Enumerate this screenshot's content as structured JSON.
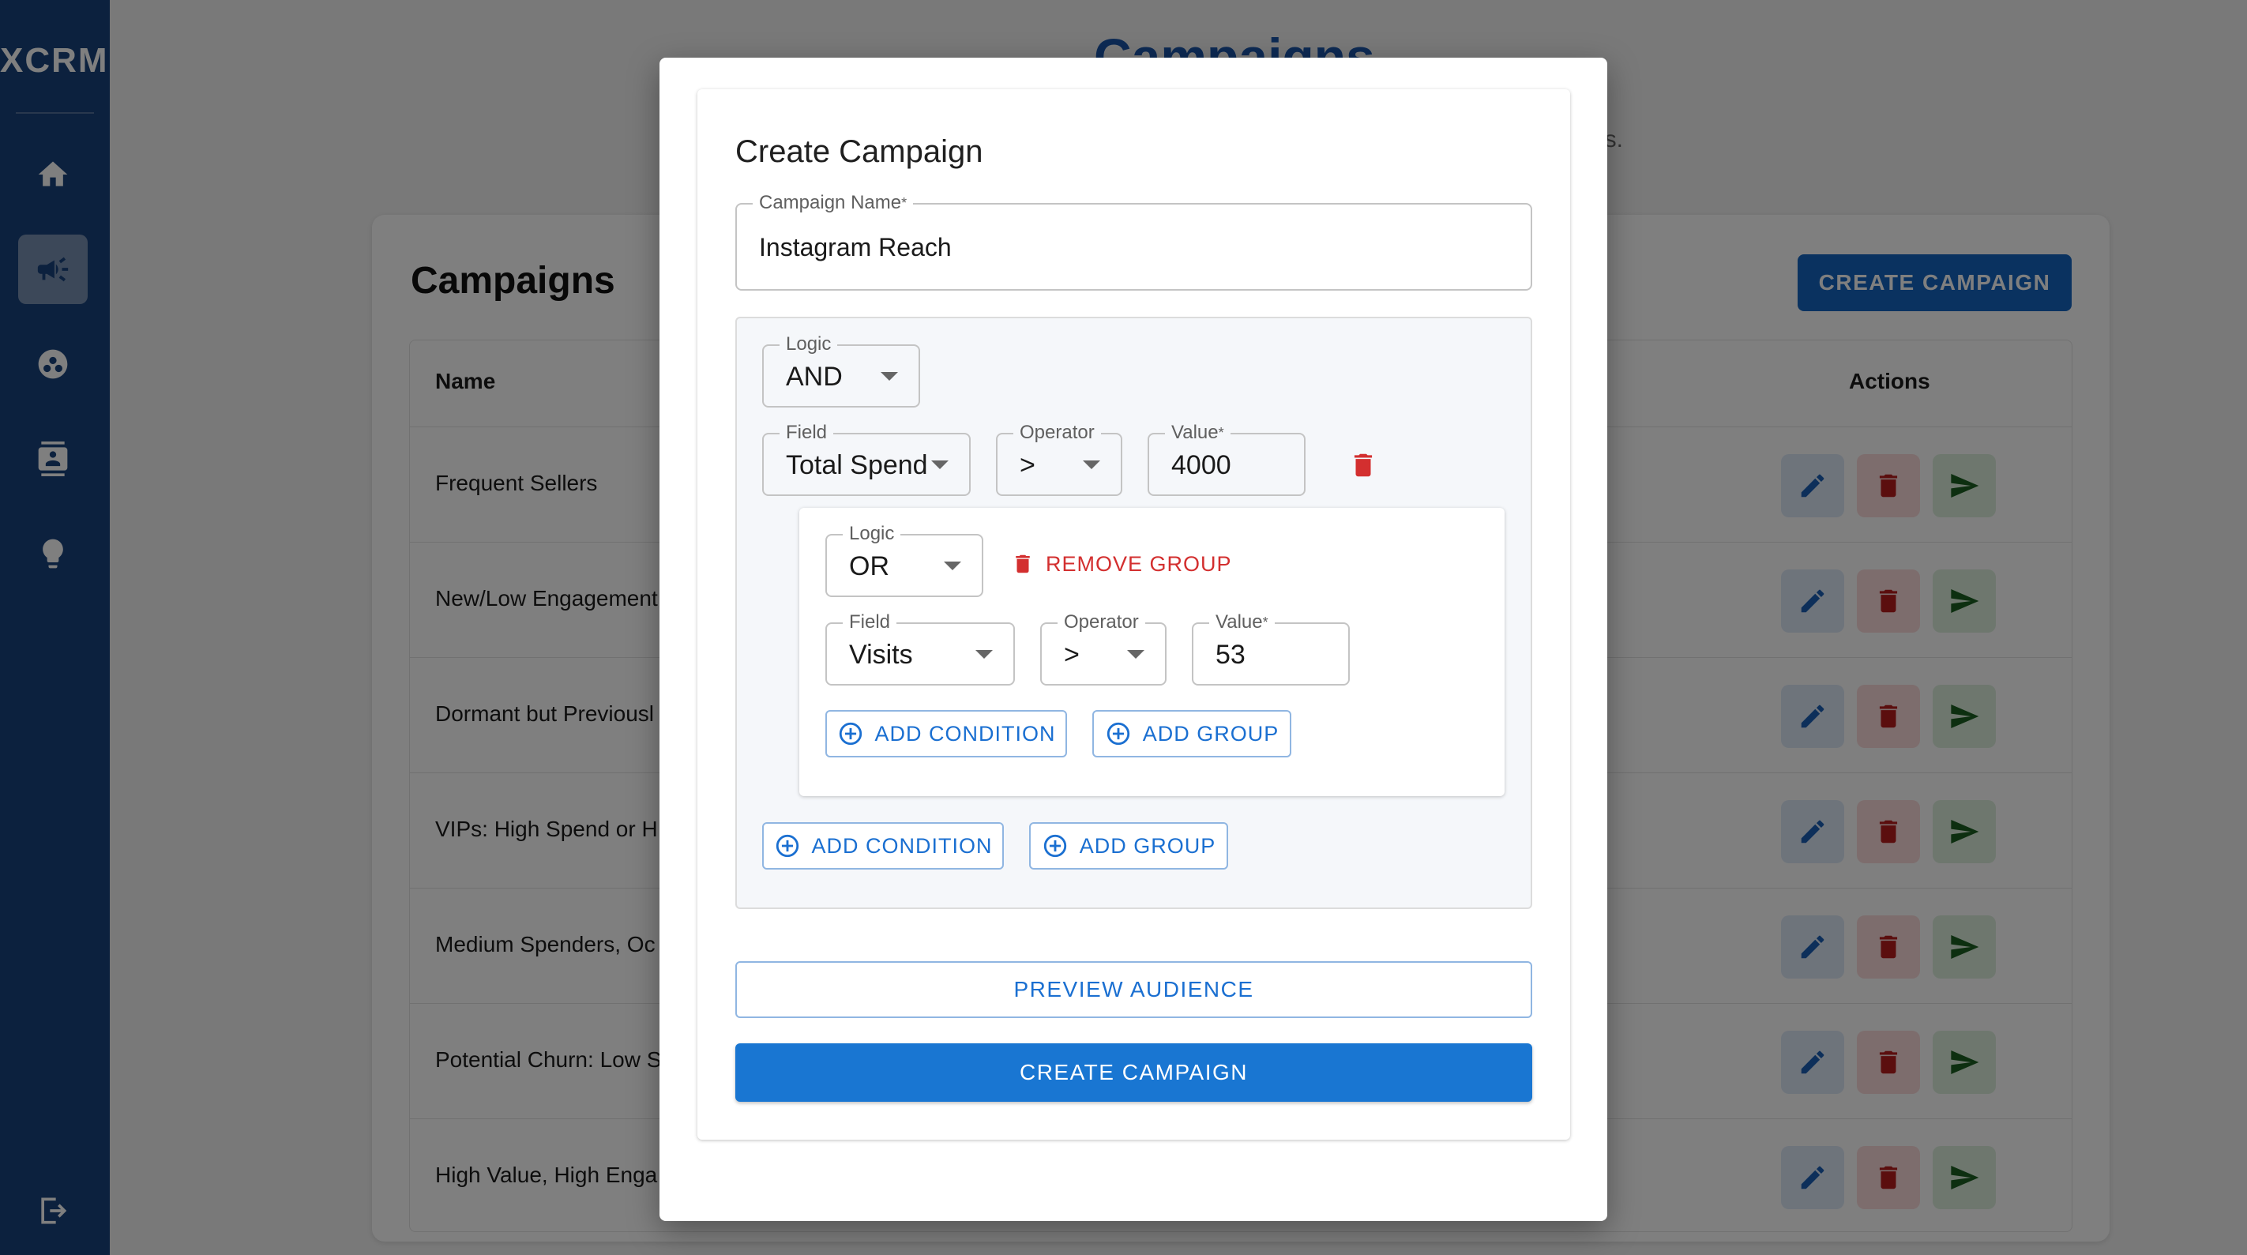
{
  "app": {
    "brand": "XCRM"
  },
  "sidebar": {
    "items": [
      {
        "icon": "home-icon"
      },
      {
        "icon": "megaphone-icon",
        "active": true
      },
      {
        "icon": "segments-icon"
      },
      {
        "icon": "contacts-icon"
      },
      {
        "icon": "lightbulb-icon"
      }
    ],
    "logout_icon": "logout-icon"
  },
  "page": {
    "title": "Campaigns",
    "subtitle_fragment": "ics.",
    "card_title": "Campaigns",
    "create_button": "CREATE CAMPAIGN",
    "table": {
      "columns": {
        "name": "Name",
        "actions": "Actions"
      },
      "rows": [
        {
          "name": "Frequent Sellers"
        },
        {
          "name": "New/Low Engagement"
        },
        {
          "name": "Dormant but Previousl"
        },
        {
          "name": "VIPs: High Spend or H"
        },
        {
          "name": "Medium Spenders, Oc"
        },
        {
          "name": "Potential Churn: Low S"
        },
        {
          "name": "High Value, High Enga"
        }
      ]
    }
  },
  "modal": {
    "title": "Create Campaign",
    "campaign_name": {
      "label": "Campaign Name",
      "required": "*",
      "value": "Instagram Reach"
    },
    "root_group": {
      "logic": {
        "label": "Logic",
        "value": "AND"
      },
      "condition": {
        "field": {
          "label": "Field",
          "value": "Total Spend"
        },
        "operator": {
          "label": "Operator",
          "value": ">"
        },
        "value": {
          "label": "Value",
          "required": "*",
          "value": "4000"
        }
      },
      "add_condition": "ADD CONDITION",
      "add_group": "ADD GROUP"
    },
    "nested_group": {
      "logic": {
        "label": "Logic",
        "value": "OR"
      },
      "remove_group": "REMOVE GROUP",
      "condition": {
        "field": {
          "label": "Field",
          "value": "Visits"
        },
        "operator": {
          "label": "Operator",
          "value": ">"
        },
        "value": {
          "label": "Value",
          "required": "*",
          "value": "53"
        }
      },
      "add_condition": "ADD CONDITION",
      "add_group": "ADD GROUP"
    },
    "preview_button": "PREVIEW AUDIENCE",
    "create_button": "CREATE CAMPAIGN"
  },
  "colors": {
    "sidebar": "#19427c",
    "primary": "#1976d2",
    "danger": "#d32f2f",
    "success": "#2e7d32"
  }
}
